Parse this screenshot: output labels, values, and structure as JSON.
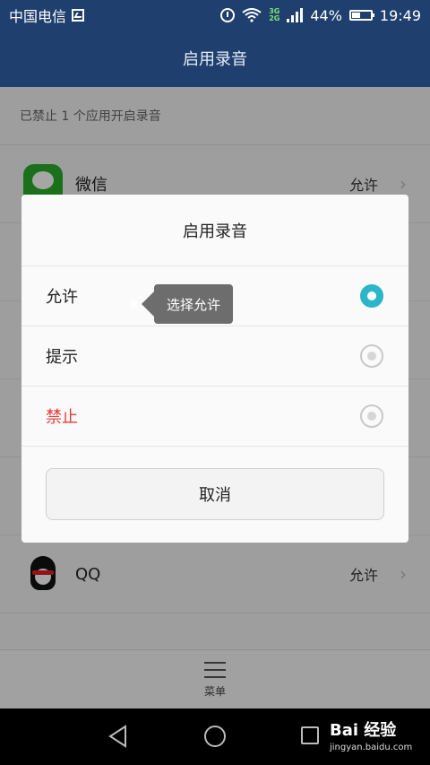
{
  "status_bar": {
    "carrier": "中国电信",
    "network_top": "3G",
    "network_bottom": "2G",
    "battery_percent": "44%",
    "battery_level": 0.44,
    "time": "19:49"
  },
  "header": {
    "title": "启用录音"
  },
  "list": {
    "summary": "已禁止 1 个应用开启录音",
    "rows": [
      {
        "name": "微信",
        "permission": "允许",
        "icon": "wechat-icon"
      },
      {
        "name": "QQ",
        "permission": "允许",
        "icon": "qq-icon"
      }
    ]
  },
  "dialog": {
    "title": "启用录音",
    "options": [
      {
        "label": "允许",
        "selected": true
      },
      {
        "label": "提示",
        "selected": false
      },
      {
        "label": "禁止",
        "selected": false,
        "color": "#e23b3b"
      }
    ],
    "cancel_label": "取消"
  },
  "annotation": {
    "text": "选择允许"
  },
  "bottom_menu": {
    "label": "菜单"
  },
  "watermark": {
    "main": "Bai  经验",
    "sub": "jingyan.baidu.com"
  },
  "colors": {
    "header_bg": "#1f3f6f",
    "accent": "#2ab6c8",
    "danger": "#e23b3b"
  }
}
